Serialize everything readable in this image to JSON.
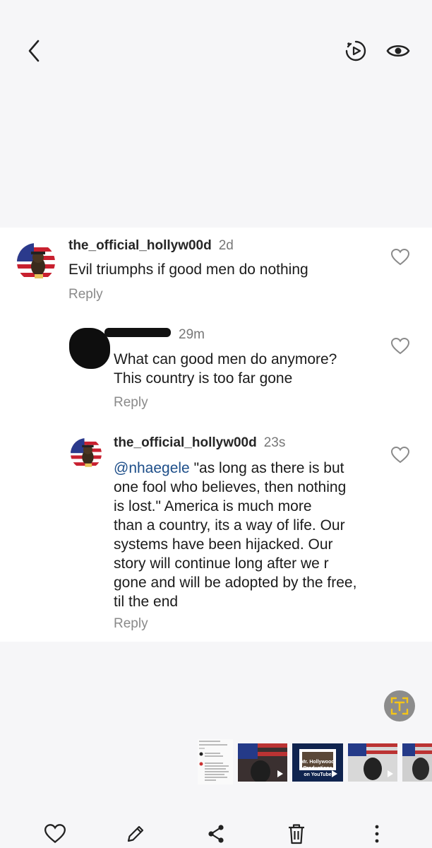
{
  "header": {
    "back_icon": "chevron-left-icon",
    "motion_icon": "motion-photo-icon",
    "view_icon": "eye-icon"
  },
  "comments": [
    {
      "username": "the_official_hollyw00d",
      "time": "2d",
      "text": "Evil triumphs if good men do nothing",
      "reply_label": "Reply"
    },
    {
      "username_redacted": true,
      "time": "29m",
      "text_line1": "What can good men do anymore?",
      "text_line2": "This country is too far gone",
      "reply_label": "Reply"
    },
    {
      "username": "the_official_hollyw00d",
      "time": "23s",
      "mention": "@nhaegele",
      "text_lines": [
        " \"as long as there is but",
        "one fool who believes, then nothing",
        "is lost.\" America is much more",
        "than a country, its a way of life. Our",
        "systems have been hijacked. Our",
        "story will continue long after we r",
        "gone and will be adopted by the free,",
        "til the end"
      ],
      "reply_label": "Reply"
    }
  ],
  "filmstrip": {
    "thumb2_line1": "Mr. Hollywood Productions",
    "thumb2_line2": "on YouTube"
  },
  "bottom_bar": {
    "icons": [
      "heart-icon",
      "pencil-icon",
      "share-icon",
      "trash-icon",
      "more-vertical-icon"
    ]
  },
  "colors": {
    "background": "#f6f6f8",
    "mention": "#1d4e89",
    "text_fab": "#8c8c8c",
    "text_fab_icon": "#f5c518"
  }
}
